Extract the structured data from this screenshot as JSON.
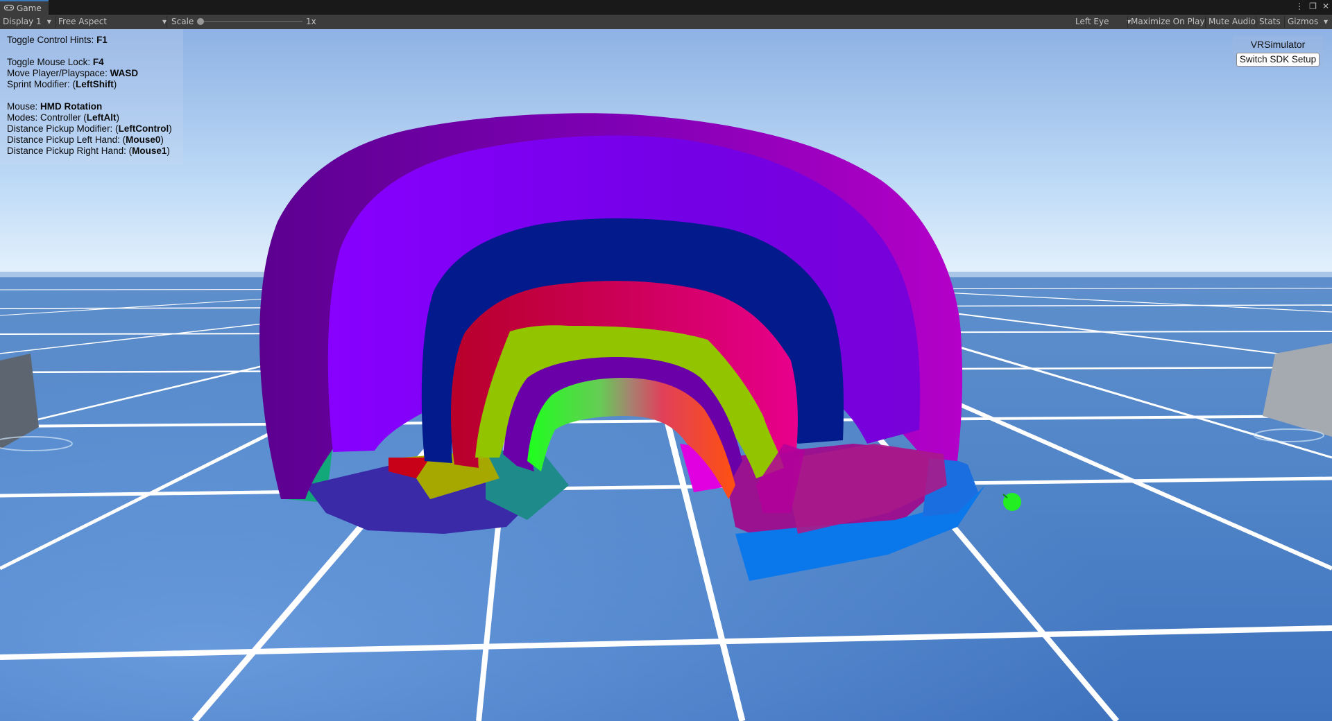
{
  "tab": {
    "title": "Game",
    "icon": "gamepad-icon"
  },
  "window_controls": {
    "menu_icon": "kebab-icon",
    "maximize_icon": "maximize-icon",
    "close_icon": "close-icon"
  },
  "toolbar": {
    "display": "Display 1",
    "aspect": "Free Aspect",
    "scale_label": "Scale",
    "scale_value": "1x",
    "eye": "Left Eye",
    "maximize_on_play": "Maximize On Play",
    "mute_audio": "Mute Audio",
    "stats": "Stats",
    "gizmos": "Gizmos"
  },
  "hints": {
    "toggle_hints": {
      "label": "Toggle Control Hints: ",
      "key": "F1"
    },
    "mouse_lock": {
      "label": "Toggle Mouse Lock: ",
      "key": "F4"
    },
    "move": {
      "label": "Move Player/Playspace: ",
      "key": "WASD"
    },
    "sprint": {
      "label": "Sprint Modifier: (",
      "key": "LeftShift",
      "suffix": ")"
    },
    "mouse": {
      "label": "Mouse: ",
      "key": "HMD Rotation"
    },
    "modes": {
      "label": "Modes: Controller (",
      "key": "LeftAlt",
      "suffix": ")"
    },
    "pickup_mod": {
      "label": "Distance Pickup Modifier: (",
      "key": "LeftControl",
      "suffix": ")"
    },
    "pickup_left": {
      "label": "Distance Pickup Left Hand: (",
      "key": "Mouse0",
      "suffix": ")"
    },
    "pickup_right": {
      "label": "Distance Pickup Right Hand: (",
      "key": "Mouse1",
      "suffix": ")"
    }
  },
  "vr_simulator": {
    "title": "VRSimulator",
    "button": "Switch SDK Setup"
  },
  "colors": {
    "accent_tab": "#3a79bb",
    "sky_top": "#8fb3e6",
    "floor": "#4c80c8",
    "outer_arch": "#8c00c4",
    "second_arch": "#8400ff",
    "third_arch": "#021a8c",
    "fourth_arch": "#c4003c",
    "fifth_arch": "#9cc800",
    "inner_arch": "#7a00b4",
    "hand_marker": "#22ee22"
  }
}
